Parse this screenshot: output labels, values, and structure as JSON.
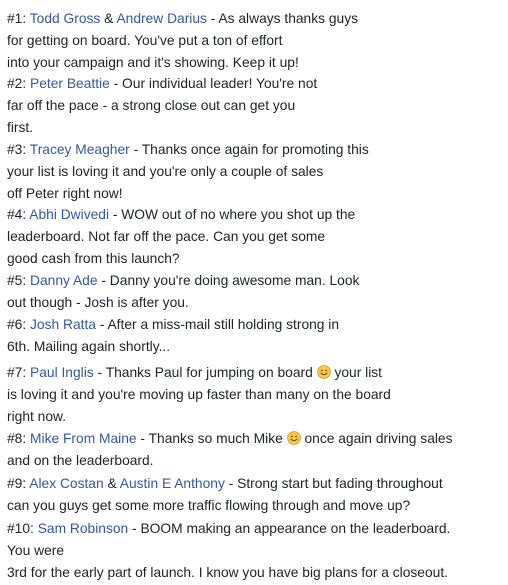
{
  "entries": [
    {
      "rank": "#1:",
      "names": [
        "Todd Gross",
        "Andrew Darius"
      ],
      "joiner": " & ",
      "lines": [
        " - As always thanks guys",
        "for getting on board. You've put a ton of effort",
        "into your campaign and it's showing. Keep it up!"
      ]
    },
    {
      "rank": "#2:",
      "names": [
        "Peter Beattie"
      ],
      "lines": [
        " - Our individual leader! You're not",
        "far off the pace - a strong close out can get you",
        "first."
      ]
    },
    {
      "rank": "#3:",
      "names": [
        "Tracey Meagher"
      ],
      "lines": [
        " - Thanks once again for promoting this",
        "your list is loving it and you're only a couple of sales",
        "off Peter right now!"
      ]
    },
    {
      "rank": "#4:",
      "names": [
        "Abhi Dwivedi"
      ],
      "lines": [
        " - WOW out of no where you shot up the",
        "leaderboard. Not far off the pace. Can you get some",
        "good cash from this launch?"
      ]
    },
    {
      "rank": "#5:",
      "names": [
        "Danny Ade"
      ],
      "lines": [
        " - Danny you're doing awesome man. Look",
        "out though - Josh is after you."
      ]
    },
    {
      "rank": "#6:",
      "names": [
        "Josh Ratta"
      ],
      "lines": [
        " - After a miss-mail still holding strong in",
        "6th. Mailing again shortly..."
      ]
    },
    {
      "rank": "#7:",
      "names": [
        "Paul Inglis"
      ],
      "lines": [
        " - Thanks Paul for jumping on board",
        " your list",
        "is loving it and you're moving up faster than many on the board",
        "right now."
      ]
    },
    {
      "rank": "#8:",
      "names": [
        "Mike From Maine"
      ],
      "lines": [
        " - Thanks so much Mike",
        " once again driving sales",
        "and on the leaderboard."
      ]
    },
    {
      "rank": "#9:",
      "names": [
        "Alex Costan",
        "Austin E Anthony"
      ],
      "joiner": " & ",
      "lines": [
        " - Strong start but fading throughout",
        "can you guys get some more traffic flowing through and move up?"
      ]
    },
    {
      "rank": "#10:",
      "names": [
        "Sam Robinson"
      ],
      "lines": [
        " - BOOM making an appearance on the leaderboard.",
        "You were",
        "3rd for the early part of launch. I know you have big plans for a closeout."
      ]
    }
  ],
  "colors": {
    "text": "#1d2129",
    "link": "#365899",
    "emoji": "#f7c948"
  },
  "icons": {
    "smiley": "smiley-emoji-icon"
  }
}
